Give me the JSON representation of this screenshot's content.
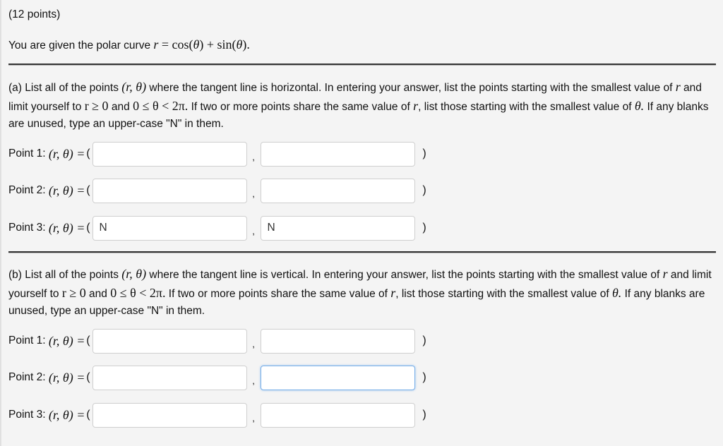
{
  "question": {
    "points_label": "(12 points)",
    "intro_text": "You are given the polar curve",
    "intro_math": {
      "var": "r",
      "eq": " = cos(",
      "theta1": "θ",
      "mid": ") + sin(",
      "theta2": "θ",
      "end": ")."
    }
  },
  "parts": [
    {
      "prefix": "(a) List all of the points",
      "pair": "(r, θ)",
      "text1": "where the tangent line is horizontal. In entering your answer, list the points starting with the smallest value of",
      "r": "r",
      "text2": "and limit yourself to",
      "cond1": "r ≥ 0",
      "and": "and",
      "cond2": "0 ≤ θ < 2π.",
      "text3": "If two or more points share the same value of",
      "text4": ", list those starting with the smallest value of",
      "theta": "θ.",
      "text5": "If any blanks are unused, type an upper-case \"N\" in them.",
      "rows": [
        {
          "label": "Point 1:",
          "pair": "(r, θ) =",
          "open": "(",
          "r_value": "",
          "theta_value": "",
          "comma": ",",
          "close": ")"
        },
        {
          "label": "Point 2:",
          "pair": "(r, θ) =",
          "open": "(",
          "r_value": "",
          "theta_value": "",
          "comma": ",",
          "close": ")"
        },
        {
          "label": "Point 3:",
          "pair": "(r, θ) =",
          "open": "(",
          "r_value": "N",
          "theta_value": "N",
          "comma": ",",
          "close": ")"
        }
      ]
    },
    {
      "prefix": "(b) List all of the points",
      "pair": "(r, θ)",
      "text1": "where the tangent line is vertical. In entering your answer, list the points starting with the smallest value of",
      "r": "r",
      "text2": "and limit yourself to",
      "cond1": "r ≥ 0",
      "and": "and",
      "cond2": "0 ≤ θ < 2π.",
      "text3": "If two or more points share the same value of",
      "text4": ", list those starting with the smallest value of",
      "theta": "θ.",
      "text5": "If any blanks are unused, type an upper-case \"N\" in them.",
      "rows": [
        {
          "label": "Point 1:",
          "pair": "(r, θ) =",
          "open": "(",
          "r_value": "",
          "theta_value": "",
          "comma": ",",
          "close": ")"
        },
        {
          "label": "Point 2:",
          "pair": "(r, θ) =",
          "open": "(",
          "r_value": "",
          "theta_value": "",
          "comma": ",",
          "close": ")",
          "focused": "theta"
        },
        {
          "label": "Point 3:",
          "pair": "(r, θ) =",
          "open": "(",
          "r_value": "",
          "theta_value": "",
          "comma": ",",
          "close": ")"
        }
      ]
    }
  ],
  "colors": {
    "background": "#f4f4f4",
    "input_border": "#cfcfcf",
    "focus_border": "#76aee8"
  }
}
